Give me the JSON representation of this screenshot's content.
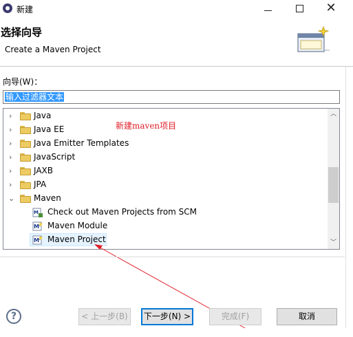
{
  "window": {
    "title": "新建"
  },
  "header": {
    "title": "选择向导",
    "description": "Create a Maven Project"
  },
  "filter": {
    "label": "向导(W)：",
    "value": "输入过滤器文本"
  },
  "tree": {
    "items": [
      {
        "label": "Java",
        "kind": "folder",
        "state": "collapsed"
      },
      {
        "label": "Java EE",
        "kind": "folder",
        "state": "collapsed"
      },
      {
        "label": "Java Emitter Templates",
        "kind": "folder",
        "state": "collapsed"
      },
      {
        "label": "JavaScript",
        "kind": "folder",
        "state": "collapsed"
      },
      {
        "label": "JAXB",
        "kind": "folder",
        "state": "collapsed"
      },
      {
        "label": "JPA",
        "kind": "folder",
        "state": "collapsed"
      },
      {
        "label": "Maven",
        "kind": "folder",
        "state": "expanded"
      },
      {
        "label": "Check out Maven Projects from SCM",
        "kind": "maven-wizard"
      },
      {
        "label": "Maven Module",
        "kind": "maven-wizard"
      },
      {
        "label": "Maven Project",
        "kind": "maven-wizard",
        "selected": true
      }
    ]
  },
  "annotation": {
    "text": "新建maven项目",
    "color": "#e0202a"
  },
  "buttons": {
    "back": "< 上一步(B)",
    "next": "下一步(N) >",
    "finish": "完成(F)",
    "cancel": "取消"
  },
  "colors": {
    "selection": "#3399ff",
    "default_button_border": "#0078d7"
  }
}
